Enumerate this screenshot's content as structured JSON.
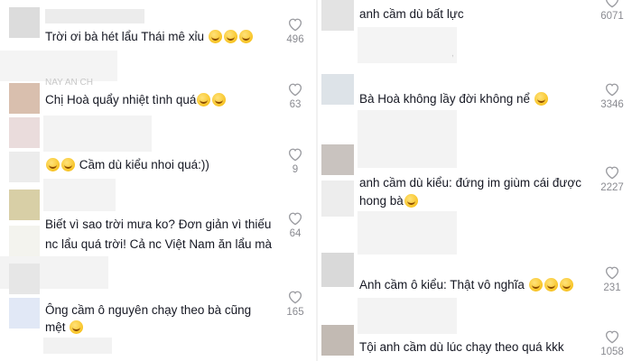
{
  "left_comments": [
    {
      "text": "Trời ơi bà hét lẩu Thái mê xỉu",
      "emojis": [
        "grinning-sweat-emoji",
        "grinning-sweat-emoji",
        "grinning-sweat-emoji"
      ],
      "likes": "496"
    },
    {
      "username": "NAY AN CH",
      "text": "Chị Hoà quẩy nhiệt tình quá",
      "emojis": [
        "tears-of-joy-emoji",
        "tears-of-joy-emoji"
      ],
      "likes": "63"
    },
    {
      "text": "Cầm dù kiểu nhoi quá:))",
      "lead_emojis": [
        "tears-of-joy-emoji",
        "tears-of-joy-emoji"
      ],
      "likes": "9"
    },
    {
      "text_line1": "Biết vì sao trời mưa ko? Đơn giản vì thiếu",
      "text_line2": "nc lẩu quá trời! Cả nc Việt Nam ăn lẩu mà",
      "likes": "64"
    },
    {
      "text_line1": "Ông cầm ô nguyên chạy theo bà cũng",
      "text_line2": "mệt",
      "emojis": [
        "tears-of-joy-emoji"
      ],
      "likes": "165"
    }
  ],
  "right_comments": [
    {
      "text": "anh cầm dù bất lực",
      "likes": "6071"
    },
    {
      "text": "Bà Hoà không lầy đời không nể",
      "emojis": [
        "grinning-sweat-emoji"
      ],
      "likes": "3346"
    },
    {
      "text_line1": "anh cầm dù kiểu: đứng im giùm cái được",
      "text_line2": "hong bà",
      "emojis": [
        "grinning-sweat-emoji"
      ],
      "likes": "2227"
    },
    {
      "text": "Anh cầm ô kiểu: Thật vô nghĩa",
      "emojis": [
        "tears-of-joy-emoji",
        "tears-of-joy-emoji",
        "tears-of-joy-emoji"
      ],
      "likes": "231"
    },
    {
      "text": "Tội anh cầm dù lúc chạy theo quá kkk",
      "likes": "1058"
    }
  ],
  "icons": {
    "like": "heart-outline-icon"
  },
  "colors": {
    "text": "#161823",
    "count": "#8a8b91",
    "placeholder": "#f2f2f2"
  }
}
